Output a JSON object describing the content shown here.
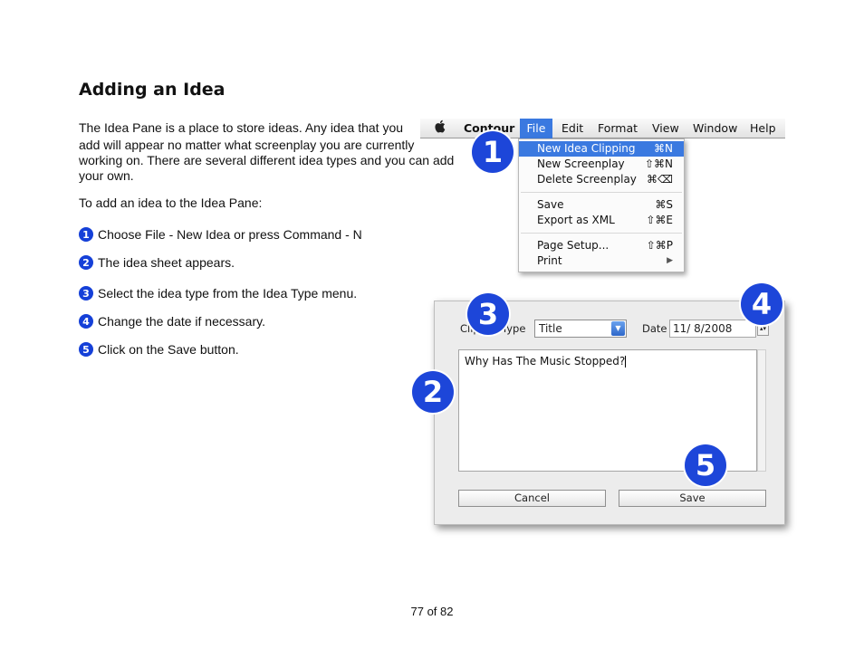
{
  "heading": "Adding an Idea",
  "intro_line1": "The Idea Pane is a place to store ideas. Any idea that you",
  "intro_line2": "add will appear no matter what screenplay you are currently working on. There are several different idea types and you can add your own.",
  "subheading": "To add an idea to the Idea Pane:",
  "steps": [
    {
      "num": "1",
      "text": "Choose File - New Idea or press Command - N"
    },
    {
      "num": "2",
      "text": "The idea sheet appears."
    },
    {
      "num": "3",
      "text": "Select the idea type from the Idea Type menu."
    },
    {
      "num": "4",
      "text": "Change the date if necessary."
    },
    {
      "num": "5",
      "text": "Click on the Save button."
    }
  ],
  "menubar": {
    "apple": "",
    "app_name": "Contour",
    "items": [
      "File",
      "Edit",
      "Format",
      "View",
      "Window",
      "Help"
    ]
  },
  "file_menu": [
    {
      "label": "New Idea Clipping",
      "shortcut": "⌘N",
      "highlighted": true
    },
    {
      "label": "New Screenplay",
      "shortcut": "⇧⌘N"
    },
    {
      "label": "Delete Screenplay",
      "shortcut": "⌘⌫"
    },
    {
      "label": "Save",
      "shortcut": "⌘S"
    },
    {
      "label": "Export as XML",
      "shortcut": "⇧⌘E"
    },
    {
      "label": "Page Setup...",
      "shortcut": "⇧⌘P"
    },
    {
      "label": "Print",
      "shortcut": "▶"
    }
  ],
  "dialog": {
    "type_label_a": "Clip",
    "type_label_b": "Type",
    "type_value": "Title",
    "date_label": "Date",
    "date_value": "11/  8/2008",
    "text_value": "Why Has The Music Stopped?",
    "cancel_label": "Cancel",
    "save_label": "Save"
  },
  "callouts": [
    "1",
    "2",
    "3",
    "4",
    "5"
  ],
  "footer": "77 of 82",
  "colors": {
    "accent": "#1d46d9",
    "menu_highlight": "#3a79e0"
  }
}
